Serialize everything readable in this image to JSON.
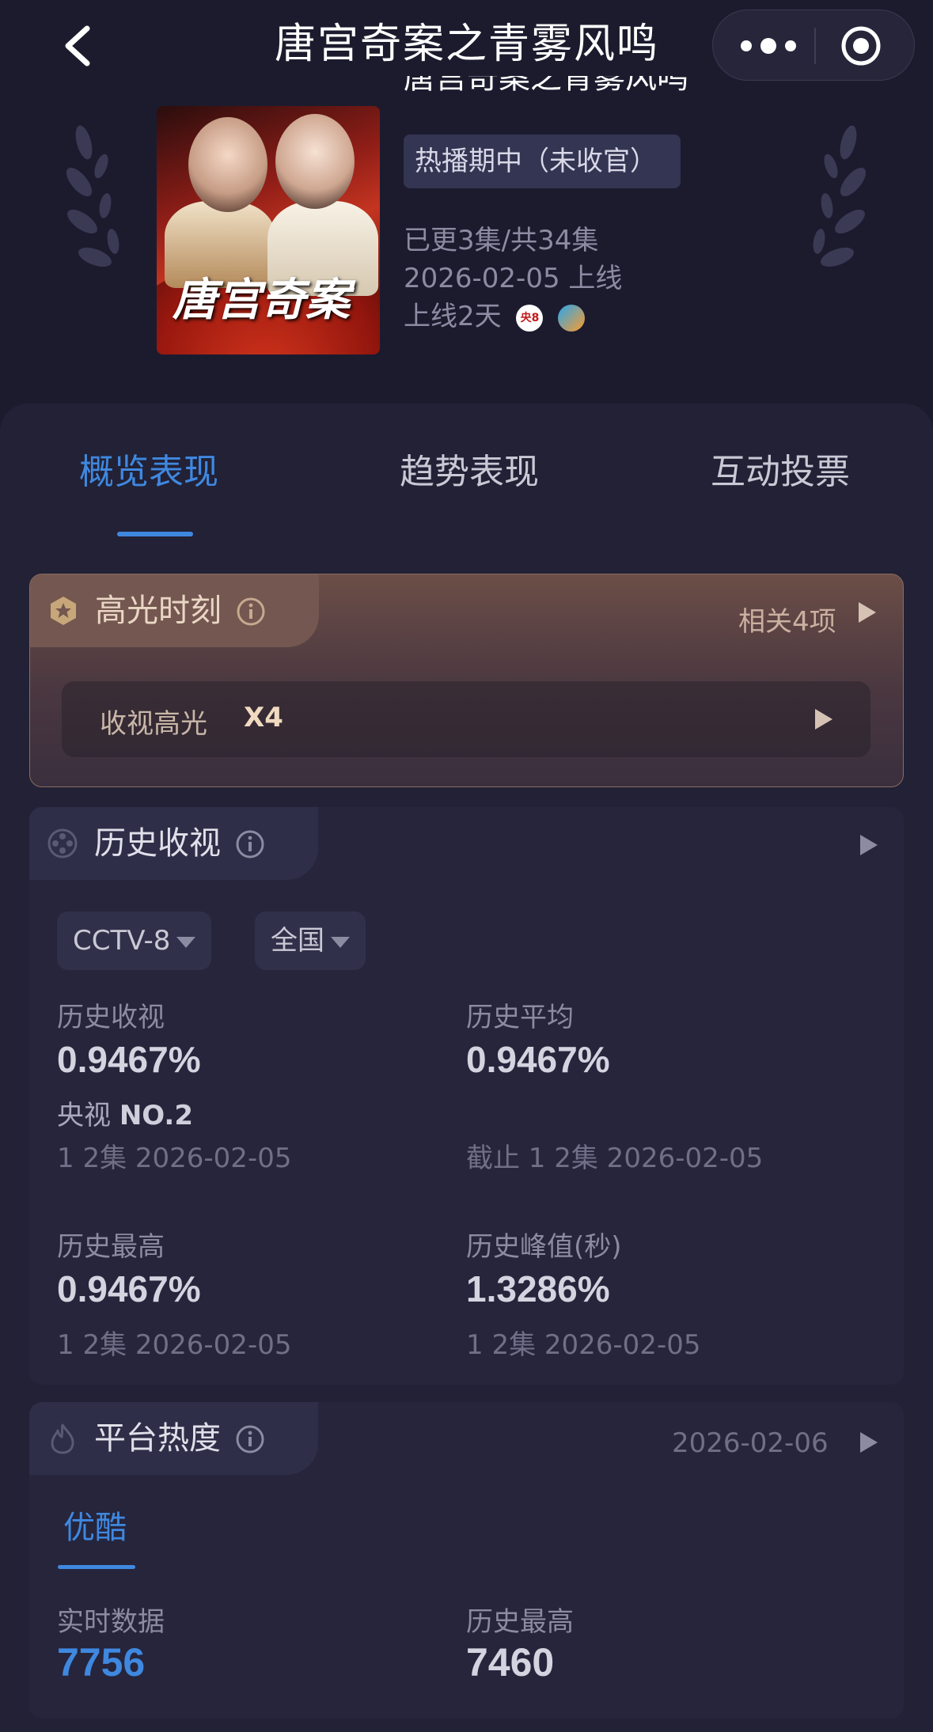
{
  "nav": {
    "title": "唐宫奇案之青雾风鸣",
    "back_icon": "chevron-left-icon",
    "more_icon": "more-dots-icon",
    "target_icon": "target-icon"
  },
  "show": {
    "poster_title": "唐宫奇案",
    "title": "唐宫奇案之青雾风鸣",
    "status_badge": "热播期中（未收官）",
    "episodes": "已更3集/共34集",
    "premiere": "2026-02-05 上线",
    "days_online": "上线2天",
    "channel_icons": [
      {
        "name": "cctv8-icon",
        "text": "央8"
      },
      {
        "name": "youku-icon"
      }
    ]
  },
  "tabs": [
    {
      "label": "概览表现",
      "active": true
    },
    {
      "label": "趋势表现",
      "active": false
    },
    {
      "label": "互动投票",
      "active": false
    }
  ],
  "highlight": {
    "title": "高光时刻",
    "related": "相关4项",
    "row_label": "收视高光",
    "row_count": "X4"
  },
  "history": {
    "title": "历史收视",
    "channel_select": "CCTV-8",
    "region_select": "全国",
    "stats": {
      "rating": {
        "label": "历史收视",
        "value": "0.9467%",
        "rank_prefix": "央视",
        "rank": "NO.2",
        "sub": "1 2集  2026-02-05"
      },
      "average": {
        "label": "历史平均",
        "value": "0.9467%",
        "sub": "截止 1 2集  2026-02-05"
      },
      "highest": {
        "label": "历史最高",
        "value": "0.9467%",
        "sub": "1 2集  2026-02-05"
      },
      "peak": {
        "label": "历史峰值(秒)",
        "value": "1.3286%",
        "sub": "1 2集  2026-02-05"
      }
    }
  },
  "platform": {
    "title": "平台热度",
    "date": "2026-02-06",
    "sub_tab": "优酷",
    "realtime_label": "实时数据",
    "realtime_value": "7756",
    "highest_label": "历史最高",
    "highest_value": "7460"
  },
  "colors": {
    "background": "#1c1b2e",
    "panel": "#222136",
    "accent_blue": "#3f88e0",
    "highlight_gold": "#f0dac0"
  }
}
